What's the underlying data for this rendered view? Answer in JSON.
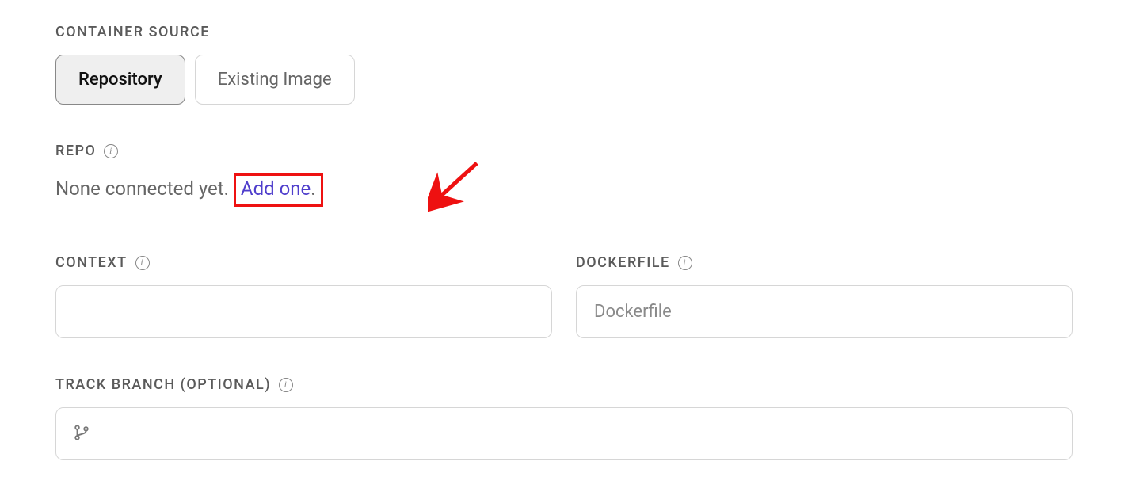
{
  "containerSource": {
    "label": "CONTAINER SOURCE",
    "options": [
      {
        "label": "Repository",
        "selected": true
      },
      {
        "label": "Existing Image",
        "selected": false
      }
    ]
  },
  "repo": {
    "label": "REPO",
    "noneText": "None connected yet.",
    "addLink": "Add one",
    "periodAfter": "."
  },
  "context": {
    "label": "CONTEXT",
    "value": "",
    "placeholder": ""
  },
  "dockerfile": {
    "label": "DOCKERFILE",
    "value": "",
    "placeholder": "Dockerfile"
  },
  "trackBranch": {
    "label": "TRACK BRANCH (OPTIONAL)",
    "value": "",
    "placeholder": ""
  },
  "annotation": {
    "highlightTarget": "add-one-link",
    "arrowPointsTo": "add-one-link"
  }
}
